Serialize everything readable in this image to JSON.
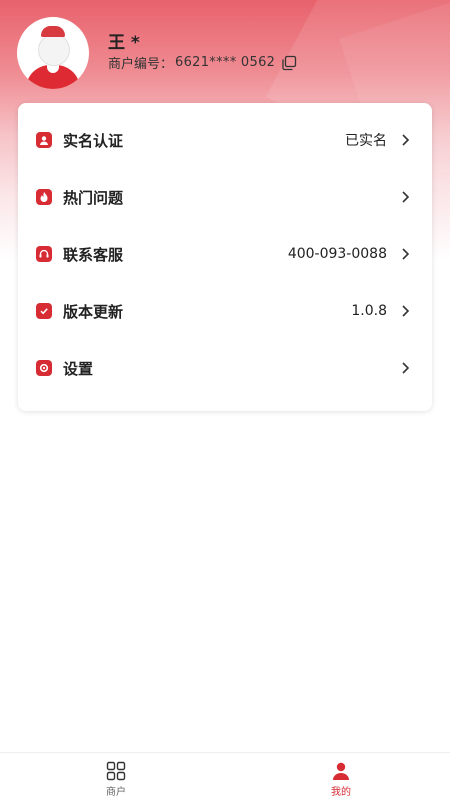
{
  "profile": {
    "name": "王 *",
    "merchant_label": "商户编号：",
    "merchant_id": "6621**** 0562"
  },
  "menu": {
    "items": [
      {
        "label": "实名认证",
        "value": "已实名",
        "icon": "id-card-icon"
      },
      {
        "label": "热门问题",
        "value": "",
        "icon": "flame-icon"
      },
      {
        "label": "联系客服",
        "value": "400-093-0088",
        "icon": "headset-icon"
      },
      {
        "label": "版本更新",
        "value": "1.0.8",
        "icon": "update-icon"
      },
      {
        "label": "设置",
        "value": "",
        "icon": "gear-icon"
      }
    ]
  },
  "tabbar": {
    "tabs": [
      {
        "label": "商户",
        "icon": "grid-icon",
        "active": false
      },
      {
        "label": "我的",
        "icon": "person-icon",
        "active": true
      }
    ]
  },
  "colors": {
    "accent": "#d72c34",
    "header_top": "#e8626c"
  }
}
